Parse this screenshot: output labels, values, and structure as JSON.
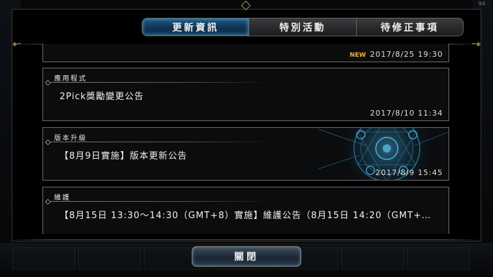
{
  "status_corner": "94 · ",
  "tabs": [
    {
      "label": "更新資訊",
      "active": true
    },
    {
      "label": "特別活動",
      "active": false
    },
    {
      "label": "待修正事項",
      "active": false
    }
  ],
  "news": [
    {
      "category": "",
      "title": "",
      "badge": "NEW",
      "date": "2017/8/25 19:30"
    },
    {
      "category": "應用程式",
      "title": "2Pick獎勵變更公告",
      "badge": "",
      "date": "2017/8/10 11:34"
    },
    {
      "category": "版本升級",
      "title": "【8月9日實施】版本更新公告",
      "badge": "",
      "date": "2017/8/9 15:45"
    },
    {
      "category": "維護",
      "title": "【8月15日 13:30～14:30（GMT+8）實施】維護公告（8月15日 14:20（GMT+…",
      "badge": "",
      "date": ""
    }
  ],
  "close_label": "關閉",
  "colors": {
    "accent_blue": "#1e5b86",
    "new_badge": "#f2b534",
    "gold_trim": "#8c7648"
  }
}
